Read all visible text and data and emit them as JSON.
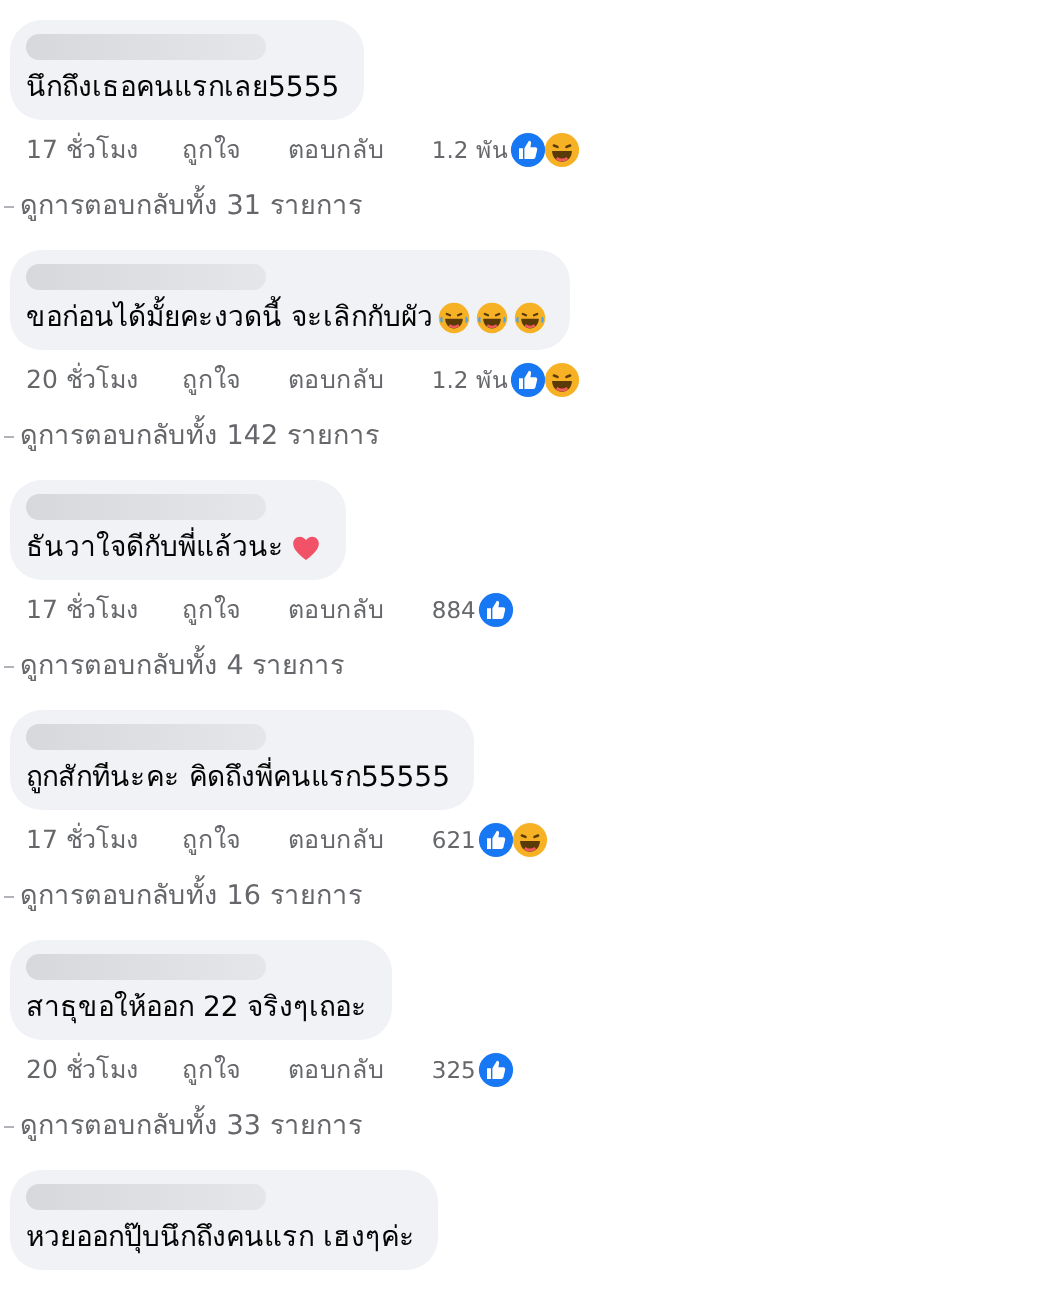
{
  "comments": [
    {
      "text": "นึกถึงเธอคนแรกเลย5555",
      "time": "17 ชั่วโมง",
      "like_label": "ถูกใจ",
      "reply_label": "ตอบกลับ",
      "reaction_count": "1.2 พัน",
      "reactions": [
        {
          "kind": "like"
        },
        {
          "kind": "haha"
        }
      ],
      "view_replies": "ดูการตอบกลับทั้ง 31 รายการ"
    },
    {
      "text": "ขอก่อนได้มั้ยคะงวดนี้ จะเลิกกับผัว",
      "emojis": [
        {
          "kind": "rofl"
        },
        {
          "kind": "rofl"
        },
        {
          "kind": "rofl"
        }
      ],
      "time": "20 ชั่วโมง",
      "like_label": "ถูกใจ",
      "reply_label": "ตอบกลับ",
      "reaction_count": "1.2 พัน",
      "reactions": [
        {
          "kind": "like"
        },
        {
          "kind": "haha"
        }
      ],
      "view_replies": "ดูการตอบกลับทั้ง 142 รายการ"
    },
    {
      "text": "ธันวาใจดีกับพี่แล้วนะ",
      "emojis": [
        {
          "kind": "heart"
        }
      ],
      "time": "17 ชั่วโมง",
      "like_label": "ถูกใจ",
      "reply_label": "ตอบกลับ",
      "reaction_count": "884",
      "reactions": [
        {
          "kind": "like"
        }
      ],
      "view_replies": "ดูการตอบกลับทั้ง 4 รายการ"
    },
    {
      "text": "ถูกสักทีนะคะ คิดถึงพี่คนแรก55555",
      "time": "17 ชั่วโมง",
      "like_label": "ถูกใจ",
      "reply_label": "ตอบกลับ",
      "reaction_count": "621",
      "reactions": [
        {
          "kind": "like"
        },
        {
          "kind": "haha"
        }
      ],
      "view_replies": "ดูการตอบกลับทั้ง 16 รายการ"
    },
    {
      "text": "สาธุขอให้ออก 22 จริงๆเถอะ",
      "time": "20 ชั่วโมง",
      "like_label": "ถูกใจ",
      "reply_label": "ตอบกลับ",
      "reaction_count": "325",
      "reactions": [
        {
          "kind": "like"
        }
      ],
      "view_replies": "ดูการตอบกลับทั้ง 33 รายการ"
    },
    {
      "text": "หวยออกปุ๊บนึกถึงคนแรก เฮงๆค่ะ"
    }
  ]
}
